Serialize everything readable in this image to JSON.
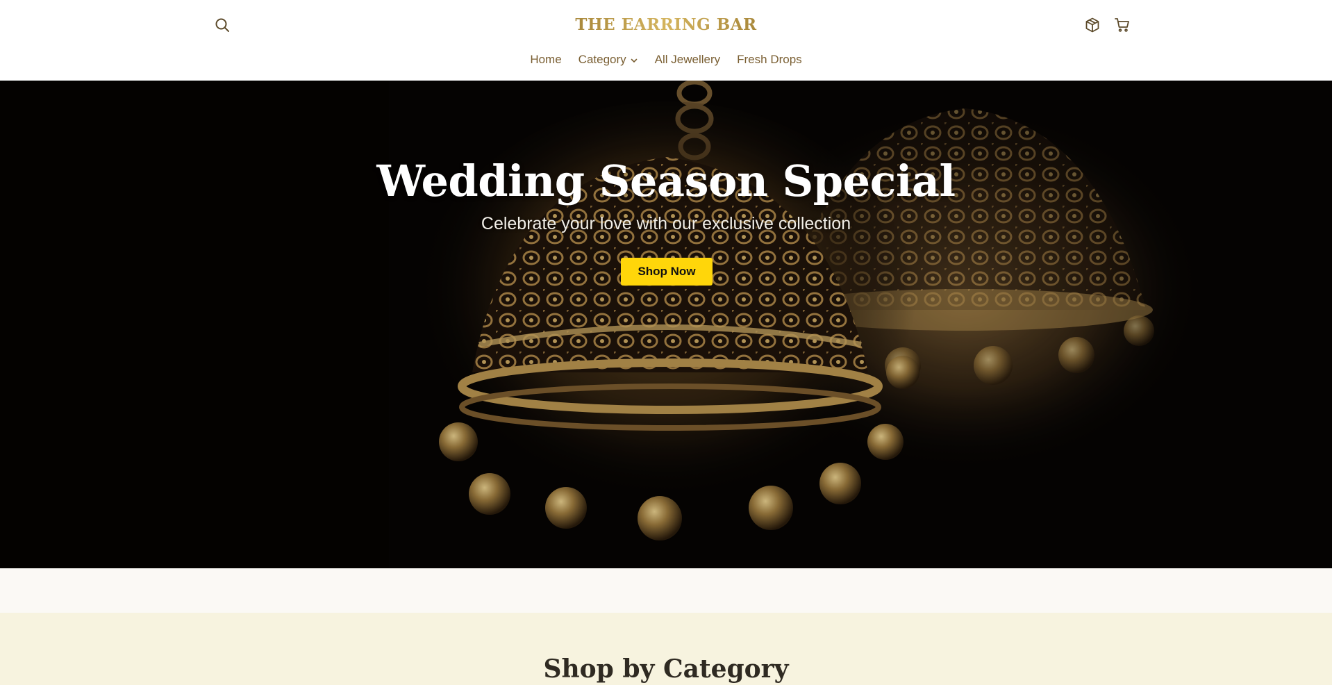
{
  "header": {
    "logo": "THE EARRING BAR",
    "icons": {
      "search": "search-icon",
      "orders": "package-icon",
      "cart": "cart-icon"
    }
  },
  "nav": {
    "items": [
      {
        "label": "Home"
      },
      {
        "label": "Category",
        "has_dropdown": true
      },
      {
        "label": "All Jewellery"
      },
      {
        "label": "Fresh Drops"
      }
    ]
  },
  "hero": {
    "title": "Wedding Season Special",
    "subtitle": "Celebrate your love with our exclusive collection",
    "cta_label": "Shop Now",
    "cta_color": "#ffd60a"
  },
  "category_section": {
    "title": "Shop by Category"
  },
  "colors": {
    "brand_gold": "#b8974a",
    "nav_text": "#7a5f33",
    "section_bg": "#f7f3df"
  }
}
